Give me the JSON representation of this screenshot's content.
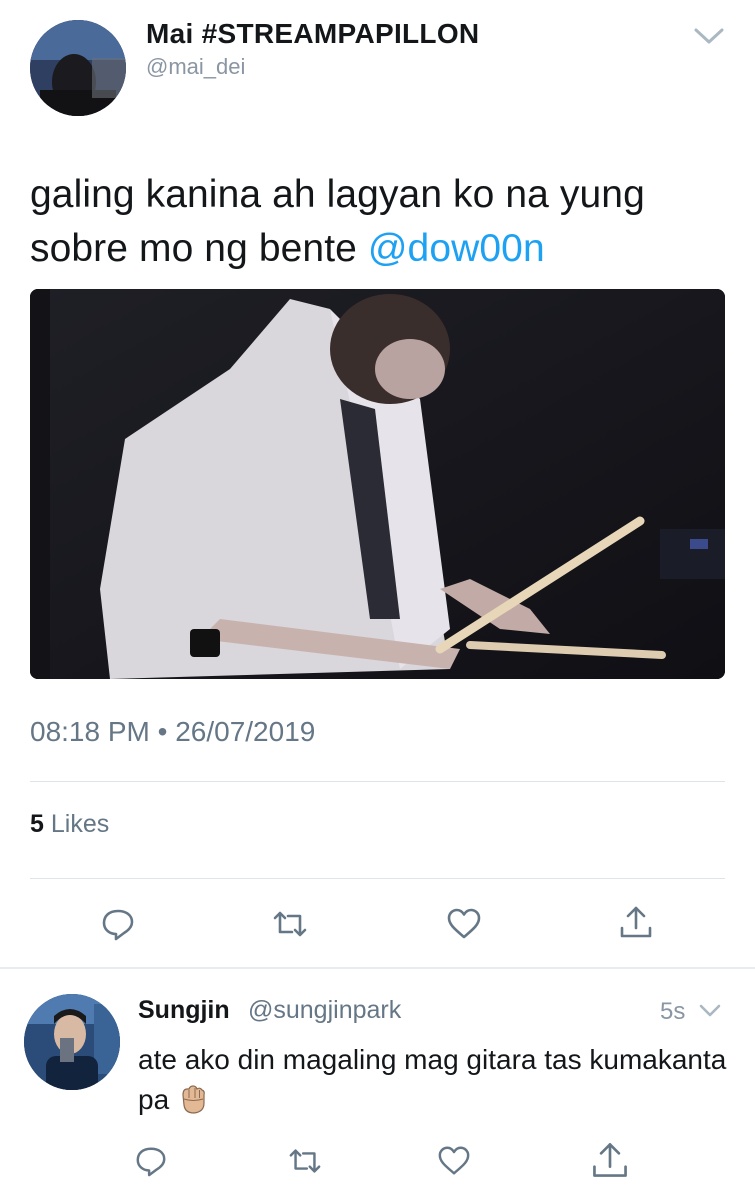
{
  "tweet": {
    "author_name": "Mai #STREAMPAPILLON",
    "author_handle": "@mai_dei",
    "text": "galing kanina ah lagyan ko na yung sobre mo ng bente ",
    "mention": "@dow00n",
    "timestamp": "08:18 PM • 26/07/2019",
    "likes_count": "5",
    "likes_label": "Likes",
    "actions": [
      "reply-icon",
      "retweet-icon",
      "like-icon",
      "share-icon"
    ]
  },
  "reply": {
    "author_name": "Sungjin",
    "author_handle": "@sungjinpark",
    "time": "5s",
    "text": "ate ako din magaling mag gitara tas kumakanta pa",
    "emoji": "raised-fist-emoji",
    "actions": [
      "reply-icon",
      "retweet-icon",
      "like-icon",
      "share-icon"
    ]
  },
  "colors": {
    "accent": "#1da1f2",
    "secondary_text": "#657786",
    "divider": "#e1e8ed"
  }
}
